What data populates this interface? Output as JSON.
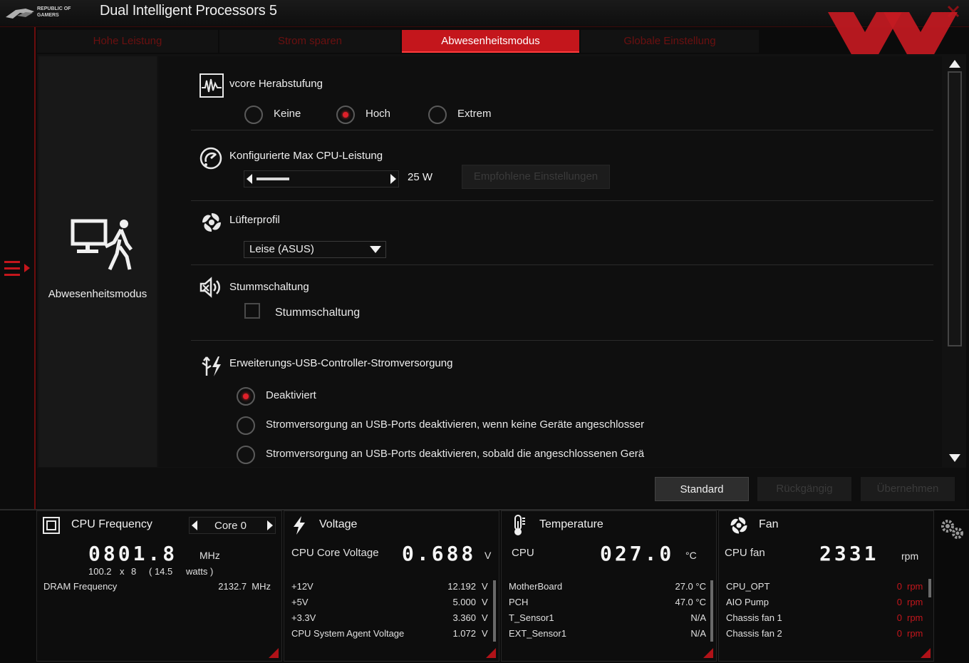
{
  "app": {
    "title": "Dual Intelligent Processors 5",
    "brand": "REPUBLIC OF GAMERS"
  },
  "tabs": [
    {
      "label": "Hohe Leistung"
    },
    {
      "label": "Strom sparen"
    },
    {
      "label": "Abwesenheitsmodus"
    },
    {
      "label": "Globale Einstellung"
    }
  ],
  "sidebar": {
    "label": "Abwesenheitsmodus"
  },
  "vcore": {
    "title": "vcore Herabstufung",
    "options": [
      "Keine",
      "Hoch",
      "Extrem"
    ],
    "selected": "Hoch"
  },
  "cpu_power": {
    "title": "Konfigurierte Max CPU-Leistung",
    "value": "25 W",
    "recommend_label": "Empfohlene Einstellungen"
  },
  "fan_profile": {
    "title": "Lüfterprofil",
    "selected": "Leise (ASUS)"
  },
  "mute": {
    "title": "Stummschaltung",
    "checkbox_label": "Stummschaltung"
  },
  "usb": {
    "title": "Erweiterungs-USB-Controller-Stromversorgung",
    "options": [
      "Deaktiviert",
      "Stromversorgung an USB-Ports deaktivieren, wenn keine Geräte angeschlosser",
      "Stromversorgung an USB-Ports deaktivieren, sobald die angeschlossenen Gerä"
    ],
    "selected": "Deaktiviert"
  },
  "actions": {
    "standard": "Standard",
    "undo": "Rückgängig",
    "apply": "Übernehmen"
  },
  "monitor": {
    "cpu": {
      "title": "CPU Frequency",
      "core_selector": "Core 0",
      "freq": "0801.8",
      "freq_unit": "MHz",
      "detail_base": "100.2",
      "detail_x": "x",
      "detail_mult": "8",
      "detail_watts": "( 14.5",
      "detail_watts_unit": "watts )",
      "dram_label": "DRAM Frequency",
      "dram_value": "2132.7  MHz"
    },
    "voltage": {
      "title": "Voltage",
      "core_label": "CPU Core Voltage",
      "core_value": "0.688",
      "core_unit": "V",
      "rows": [
        {
          "label": "+12V",
          "value": "12.192",
          "unit": "V"
        },
        {
          "label": "+5V",
          "value": "5.000",
          "unit": "V"
        },
        {
          "label": "+3.3V",
          "value": "3.360",
          "unit": "V"
        },
        {
          "label": "CPU System Agent Voltage",
          "value": "1.072",
          "unit": "V"
        }
      ]
    },
    "temperature": {
      "title": "Temperature",
      "cpu_label": "CPU",
      "cpu_value": "027.0",
      "cpu_unit": "°C",
      "rows": [
        {
          "label": "MotherBoard",
          "value": "27.0 °C"
        },
        {
          "label": "PCH",
          "value": "47.0 °C"
        },
        {
          "label": "T_Sensor1",
          "value": "N/A"
        },
        {
          "label": "EXT_Sensor1",
          "value": "N/A"
        }
      ]
    },
    "fan": {
      "title": "Fan",
      "cpu_label": "CPU fan",
      "cpu_value": "2331",
      "cpu_unit": "rpm",
      "rows": [
        {
          "label": "CPU_OPT",
          "value": "0",
          "unit": "rpm"
        },
        {
          "label": "AIO Pump",
          "value": "0",
          "unit": "rpm"
        },
        {
          "label": "Chassis fan 1",
          "value": "0",
          "unit": "rpm"
        },
        {
          "label": "Chassis fan 2",
          "value": "0",
          "unit": "rpm"
        }
      ]
    }
  },
  "colors": {
    "accent": "#c4161c",
    "background": "#0b0b0b",
    "panel": "#121212"
  }
}
